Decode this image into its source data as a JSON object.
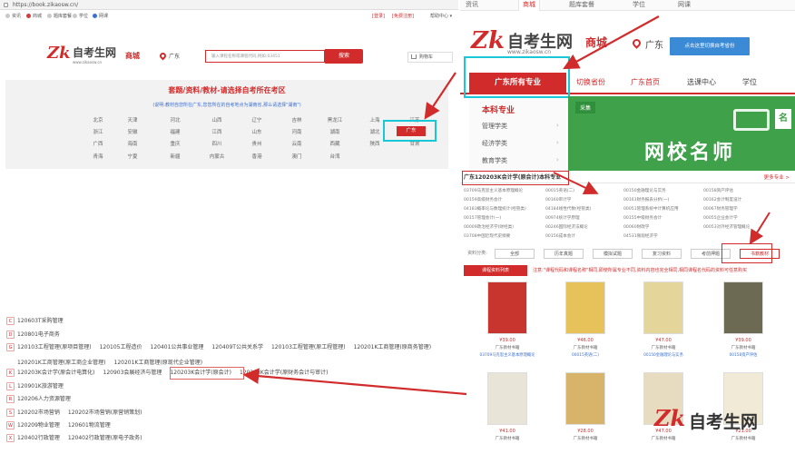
{
  "left": {
    "url": "https://book.zikaosw.cn/",
    "nav": [
      "资讯",
      "商城",
      "题库套餐",
      "学位",
      "网课"
    ],
    "top_links": [
      "[登录]",
      "[免费注册]",
      "帮助中心 ▾"
    ],
    "logo": {
      "mark": "Zk",
      "name": "自考生网",
      "domain": "www.zikaosw.cn"
    },
    "mall": "商城",
    "location": "广东",
    "search": {
      "placeholder": "输入课程名称或课程代码,例如:03451",
      "button": "搜索"
    },
    "cart": "购物车",
    "region": {
      "title": "套题/资料/教材-请选择自考所在考区",
      "hint": "(说明:教材自您所在广东,您您所在的自考地点为湖南省,那么请选择\"湖南\")",
      "rows": [
        [
          "北京",
          "天津",
          "河北",
          "山西",
          "辽宁",
          "吉林",
          "黑龙江",
          "上海",
          "江苏"
        ],
        [
          "浙江",
          "安徽",
          "福建",
          "江西",
          "山东",
          "河南",
          "湖南",
          "湖北",
          "广东"
        ],
        [
          "广西",
          "海南",
          "重庆",
          "四川",
          "贵州",
          "云南",
          "西藏",
          "陕西",
          "甘肃"
        ],
        [
          "青海",
          "宁夏",
          "新疆",
          "内蒙古",
          "香港",
          "澳门",
          "台湾"
        ]
      ],
      "selected": "广东"
    },
    "majors": [
      {
        "letter": "C",
        "items": [
          "120603T采购管理"
        ]
      },
      {
        "letter": "D",
        "items": [
          "120801电子商务"
        ]
      },
      {
        "letter": "G",
        "items": [
          "120103工程管理(原项目管理)",
          "120105工程造价",
          "120401公共事业管理",
          "120409T公共关系学",
          "120103工程管理(原工程管理)",
          "120201K工商管理(原商务管理)"
        ]
      },
      {
        "letter": "",
        "items": [
          "120201K工商管理(原工商企业管理)",
          "120201K工商管理(原现代企业管理)"
        ]
      },
      {
        "letter": "K",
        "items": [
          "120203K会计学(原会计电算化)",
          "120903会展经济与管理",
          "120203K会计学(原会计)",
          "120203K会计学(原财务会计与审计)"
        ]
      },
      {
        "letter": "L",
        "items": [
          "120901K旅游管理"
        ]
      },
      {
        "letter": "R",
        "items": [
          "120206人力资源管理"
        ]
      },
      {
        "letter": "S",
        "items": [
          "120202市场营销",
          "120202市场营销(原营销策划)"
        ]
      },
      {
        "letter": "W",
        "items": [
          "120209物业管理",
          "120601物流管理"
        ]
      },
      {
        "letter": "X",
        "items": [
          "120402行政管理",
          "120402行政管理(原电子政务)"
        ]
      }
    ]
  },
  "right": {
    "tabs": [
      "资讯",
      "商城",
      "题库套餐",
      "学位",
      "网课"
    ],
    "logo": {
      "mark": "Zk",
      "name": "自考生网",
      "domain": "www.zikaosw.cn"
    },
    "mall": "商城",
    "location": "广东",
    "tooltip": "点击这里切换自考省份",
    "cat_all": "广东所有专业",
    "nav": [
      "切换省份",
      "广东首页",
      "选课中心",
      "学位"
    ],
    "sidebar": {
      "head": "本科专业",
      "items": [
        "管理学类",
        "经济学类",
        "教育学类"
      ]
    },
    "banner": {
      "tag": "采集",
      "big": "网校名师",
      "badge": "名"
    },
    "major_title": "广东120203K会计学(原会计)本科专业",
    "more": "更多专业 >",
    "courses": [
      [
        "03709马克思主义基本原理概论",
        "00015英语(二)",
        "00150金融理论与实务",
        "00158资产评估"
      ],
      [
        "00159高级财务会计",
        "00160审计学",
        "00161财务报表分析(一)",
        "00162会计制度设计"
      ],
      [
        "04183概率论与数理统计(经管类)",
        "04184线性代数(经管类)",
        "00051管理系统中计算机应用",
        "00067财务管理学"
      ],
      [
        "00157管理会计(一)",
        "00974统计学原理",
        "00155中级财务会计",
        "00055企业会计学"
      ],
      [
        "00009政治经济学(财经类)",
        "00246国际经济法概论",
        "00060财政学",
        "00053对外经济管理概论"
      ],
      [
        "03708中国近现代史纲要",
        "00156成本会计",
        "04531微观经济学"
      ]
    ],
    "filters": {
      "label": "资料分类:",
      "items": [
        "全部",
        "历年真题",
        "模拟试题",
        "复习资料",
        "考前押题",
        "书籍教材"
      ],
      "selected": "书籍教材"
    },
    "list_tab": "课程资料列表",
    "notice": "注意:\"课程代码和课程名称\"相同,即使所属专业不同,资料内容也完全相同,相同课程名代码的资料可任意购买",
    "products": [
      {
        "price": "¥39.00",
        "store": "广东教材书籍",
        "caption": "03709马克思主义基本原理概论"
      },
      {
        "price": "¥46.00",
        "store": "广东教材书籍",
        "caption": "00015英语(二)"
      },
      {
        "price": "¥47.00",
        "store": "广东教材书籍",
        "caption": "00150金融理论与实务"
      },
      {
        "price": "¥39.00",
        "store": "广东教材书籍",
        "caption": "00158资产评估"
      },
      {
        "price": "¥41.00",
        "store": "广东教材书籍",
        "caption": ""
      },
      {
        "price": "¥28.00",
        "store": "广东教材书籍",
        "caption": ""
      },
      {
        "price": "¥47.00",
        "store": "广东教材书籍",
        "caption": ""
      },
      {
        "price": "¥21.00",
        "store": "广东教材书籍",
        "caption": ""
      }
    ]
  },
  "watermark": {
    "mark": "Zk",
    "name": "自考生网"
  },
  "colors": {
    "brand_red": "#d12b2b",
    "highlight_cyan": "#18c8d6",
    "tooltip_blue": "#3a8ad6",
    "banner_green": "#3fa14a"
  }
}
